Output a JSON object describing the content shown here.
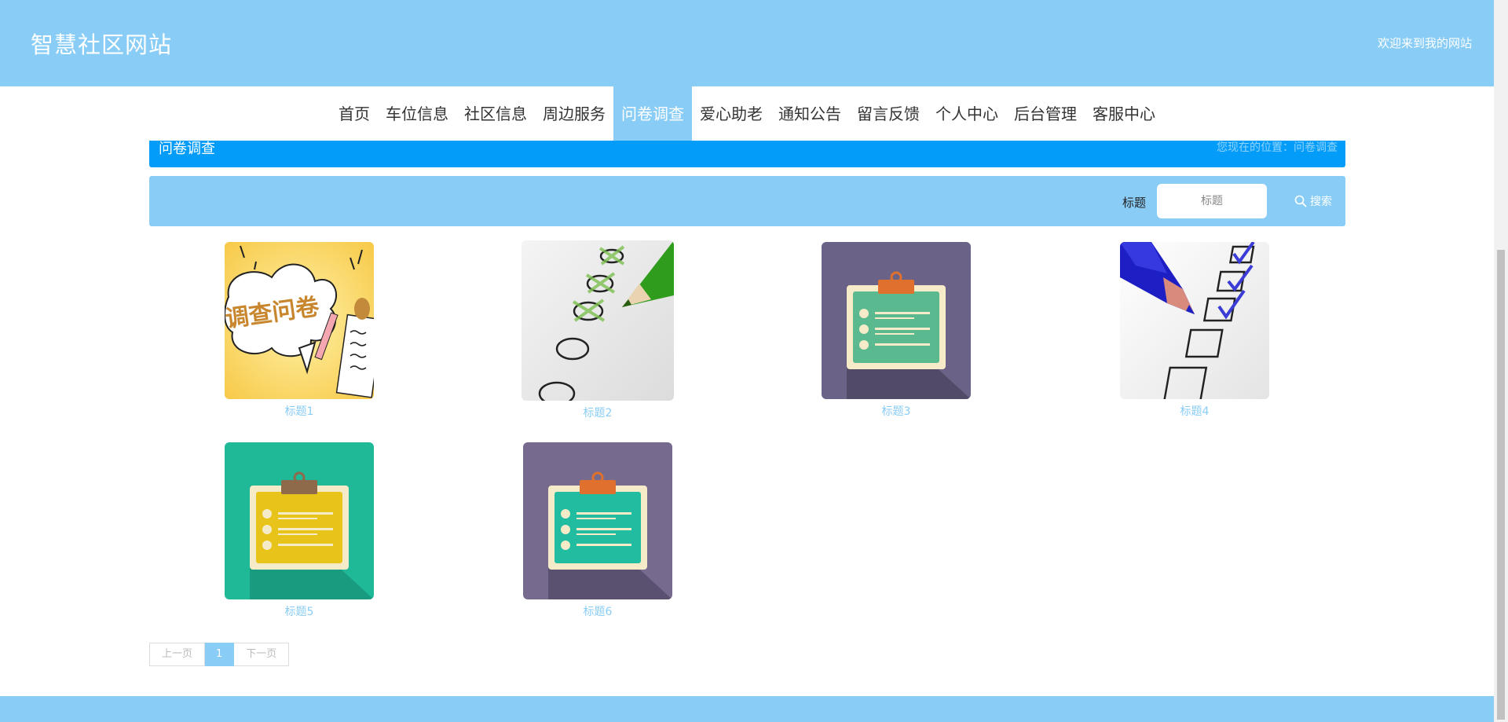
{
  "header": {
    "site_title": "智慧社区网站",
    "welcome": "欢迎来到我的网站"
  },
  "nav": [
    {
      "label": "首页",
      "active": false
    },
    {
      "label": "车位信息",
      "active": false
    },
    {
      "label": "社区信息",
      "active": false
    },
    {
      "label": "周边服务",
      "active": false
    },
    {
      "label": "问卷调查",
      "active": true
    },
    {
      "label": "爱心助老",
      "active": false
    },
    {
      "label": "通知公告",
      "active": false
    },
    {
      "label": "留言反馈",
      "active": false
    },
    {
      "label": "个人中心",
      "active": false
    },
    {
      "label": "后台管理",
      "active": false
    },
    {
      "label": "客服中心",
      "active": false
    }
  ],
  "breadcrumb": {
    "title": "问卷调查",
    "location": "您现在的位置：问卷调查"
  },
  "search": {
    "label": "标题",
    "placeholder": "标题",
    "value": "",
    "button_label": "搜索"
  },
  "cards": [
    {
      "caption": "标题1",
      "image": "survey-cartoon-illustration"
    },
    {
      "caption": "标题2",
      "image": "pencil-checkmarks-illustration"
    },
    {
      "caption": "标题3",
      "image": "clipboard-purple-illustration"
    },
    {
      "caption": "标题4",
      "image": "checkbox-pencil-illustration"
    },
    {
      "caption": "标题5",
      "image": "clipboard-green-illustration"
    },
    {
      "caption": "标题6",
      "image": "clipboard-purple-teal-illustration"
    }
  ],
  "cards_image_text": "调查问卷",
  "pagination": {
    "prev": "上一页",
    "current": "1",
    "next": "下一页"
  },
  "colors": {
    "header_bg": "#89cdf7",
    "breadcrumb_bg": "#039cf9",
    "caption": "#89cdf7"
  }
}
